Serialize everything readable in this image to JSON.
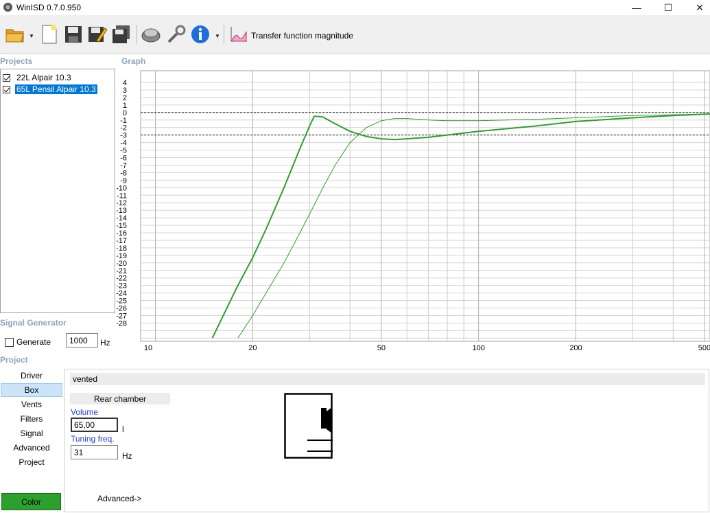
{
  "window": {
    "title": "WinISD 0.7.0.950",
    "minimize": "—",
    "maximize": "☐",
    "close": "✕"
  },
  "toolbar": {
    "view_label": "Transfer function magnitude",
    "buttons": [
      "open-folder-icon",
      "new-file-icon",
      "save-icon",
      "save-as-icon",
      "save-all-icon",
      "driver-icon",
      "tools-icon",
      "info-icon",
      "chart-icon"
    ]
  },
  "projects": {
    "title": "Projects",
    "items": [
      {
        "label": "22L Alpair 10.3",
        "checked": true,
        "selected": false,
        "color": "#2ca02c"
      },
      {
        "label": "65L Pensil Alpair 10.3",
        "checked": true,
        "selected": true,
        "color": "#2ca02c"
      }
    ]
  },
  "graph": {
    "title": "Graph",
    "y_ticks": [
      "4",
      "3",
      "2",
      "1",
      "0",
      "-1",
      "-2",
      "-3",
      "-4",
      "-5",
      "-6",
      "-7",
      "-8",
      "-9",
      "-10",
      "-11",
      "-12",
      "-13",
      "-14",
      "-15",
      "-16",
      "-17",
      "-18",
      "-19",
      "-20",
      "-21",
      "-22",
      "-23",
      "-24",
      "-25",
      "-26",
      "-27",
      "-28"
    ],
    "x_ticks": [
      "10",
      "20",
      "50",
      "100",
      "200",
      "500"
    ],
    "reference_lines_db": [
      0,
      -3
    ]
  },
  "chart_data": {
    "type": "line",
    "title": "",
    "xlabel": "",
    "ylabel": "",
    "x_scale": "log",
    "xlim": [
      9,
      520
    ],
    "ylim": [
      -30,
      5
    ],
    "grid": true,
    "series": [
      {
        "x": [
          15,
          18,
          20,
          22,
          25,
          28,
          30,
          31,
          33,
          36,
          40,
          45,
          50,
          55,
          60,
          70,
          80,
          100,
          150,
          200,
          300,
          400,
          520
        ],
        "y": [
          -30,
          -23,
          -19.3,
          -15.5,
          -10,
          -4.8,
          -1.8,
          -0.5,
          -0.6,
          -1.5,
          -2.5,
          -3.2,
          -3.5,
          -3.6,
          -3.5,
          -3.3,
          -3,
          -2.5,
          -1.8,
          -1.2,
          -0.7,
          -0.4,
          -0.2
        ],
        "color": "#2ca02c",
        "width": 2
      },
      {
        "x": [
          18,
          20,
          22,
          25,
          28,
          30,
          33,
          36,
          40,
          45,
          50,
          55,
          60,
          70,
          80,
          100,
          150,
          200,
          300,
          400,
          520
        ],
        "y": [
          -30,
          -27,
          -24,
          -20,
          -16,
          -13.5,
          -10,
          -7,
          -4,
          -2,
          -1.1,
          -0.8,
          -0.8,
          -1,
          -1.1,
          -1.1,
          -0.9,
          -0.7,
          -0.4,
          -0.3,
          -0.2
        ],
        "color": "#2ca02c",
        "width": 1
      }
    ]
  },
  "signal_generator": {
    "title": "Signal Generator",
    "generate_label": "Generate",
    "checked": false,
    "frequency": "1000",
    "unit": "Hz"
  },
  "project": {
    "title": "Project",
    "nav": [
      {
        "label": "Driver",
        "selected": false
      },
      {
        "label": "Box",
        "selected": true
      },
      {
        "label": "Vents",
        "selected": false
      },
      {
        "label": "Filters",
        "selected": false
      },
      {
        "label": "Signal",
        "selected": false
      },
      {
        "label": "Advanced",
        "selected": false
      },
      {
        "label": "Project",
        "selected": false
      }
    ],
    "color_button": "Color",
    "color": "#2ca02c",
    "box_type": "vented",
    "rear_chamber": "Rear chamber",
    "volume_label": "Volume",
    "volume_value": "65,00",
    "volume_unit": "l",
    "tuning_label": "Tuning freq.",
    "tuning_value": "31",
    "tuning_unit": "Hz",
    "advanced_link": "Advanced->"
  }
}
